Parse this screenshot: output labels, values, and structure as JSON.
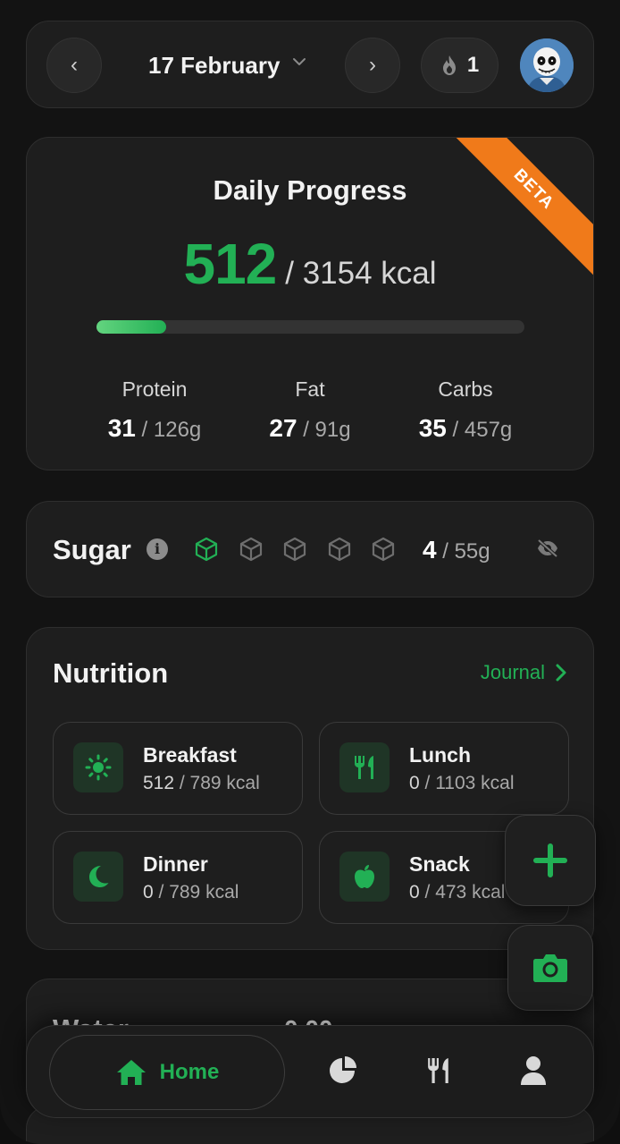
{
  "header": {
    "date": "17 February",
    "streak_count": "1",
    "prev_glyph": "‹",
    "next_glyph": "›"
  },
  "daily_progress": {
    "title": "Daily Progress",
    "badge": "BETA",
    "kcal_current": "512",
    "kcal_goal": "/ 3154 kcal",
    "progress_fraction": 0.162,
    "macros": [
      {
        "label": "Protein",
        "value": "31",
        "goal": " / 126g"
      },
      {
        "label": "Fat",
        "value": "27",
        "goal": " / 91g"
      },
      {
        "label": "Carbs",
        "value": "35",
        "goal": " / 457g"
      }
    ]
  },
  "sugar": {
    "title": "Sugar",
    "info_glyph": "i",
    "cubes_total": 5,
    "cubes_filled": 1,
    "value": "4",
    "goal": " / 55g"
  },
  "nutrition": {
    "title": "Nutrition",
    "journal_label": "Journal",
    "meals": [
      {
        "name": "Breakfast",
        "eaten": "512",
        "goal": " / 789 kcal",
        "icon": "sun-icon"
      },
      {
        "name": "Lunch",
        "eaten": "0",
        "goal": " / 1103 kcal",
        "icon": "utensils-icon"
      },
      {
        "name": "Dinner",
        "eaten": "0",
        "goal": " / 789 kcal",
        "icon": "moon-icon"
      },
      {
        "name": "Snack",
        "eaten": "0",
        "goal": " / 473 kcal",
        "icon": "apple-icon"
      }
    ]
  },
  "water": {
    "title": "Water",
    "value": "0.00"
  },
  "nav": {
    "home_label": "Home",
    "items": [
      "home-icon",
      "chart-pie-icon",
      "utensils-icon",
      "user-icon"
    ]
  },
  "colors": {
    "accent": "#22b055",
    "beta": "#f07a1a",
    "card": "#1e1e1e",
    "background": "#131313"
  }
}
